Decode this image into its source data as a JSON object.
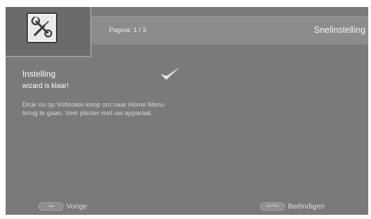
{
  "header": {
    "page_indicator": "Pagina: 1 / 3",
    "title": "Snelinstelling",
    "icon": "settings-wrench-screwdriver-icon"
  },
  "main": {
    "heading": "Instelling",
    "subheading": "wizard is klaar!",
    "status_icon": "checkmark-icon",
    "description_line1": "Druk nu op Voltooien knop om naar Home Menu",
    "description_line2": "terug te gaan. Veel plezier met uw apparaat."
  },
  "footer": {
    "back": {
      "key": "I◂◂",
      "label": "Vorige"
    },
    "finish": {
      "key": "ENTER",
      "label": "Beëindigen"
    }
  },
  "colors": {
    "background": "#7a7a7a",
    "header_band": "#8c8c8c",
    "icon_panel": "#6b6b6b",
    "text": "#ffffff",
    "muted_text": "#d6d6d6"
  }
}
